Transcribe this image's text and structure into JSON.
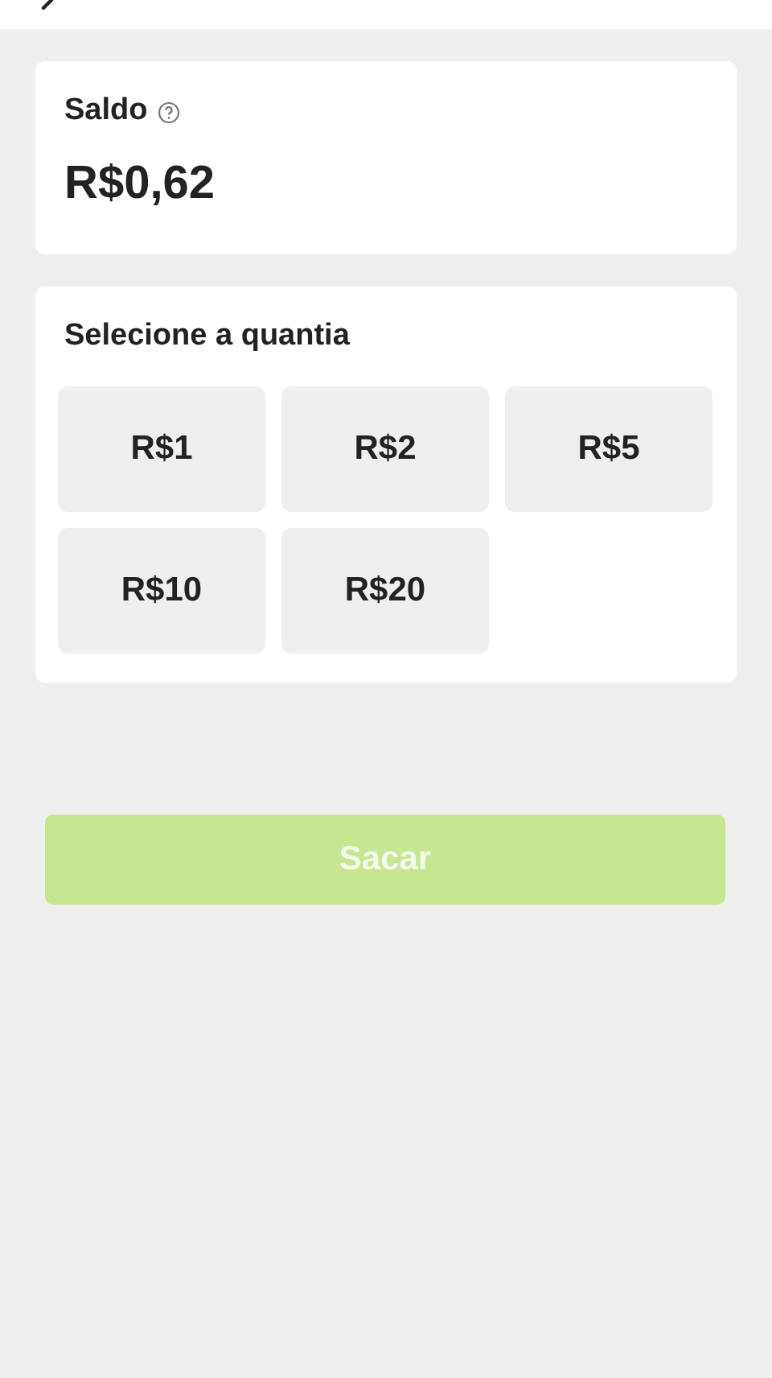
{
  "header": {
    "back": true
  },
  "balance": {
    "label": "Saldo",
    "amount": "R$0,62"
  },
  "amount_picker": {
    "title": "Selecione a quantia",
    "options": [
      {
        "label": "R$1",
        "selected": false
      },
      {
        "label": "R$2",
        "selected": false
      },
      {
        "label": "R$5",
        "selected": false
      },
      {
        "label": "R$10",
        "selected": false
      },
      {
        "label": "R$20",
        "selected": false
      }
    ]
  },
  "withdraw_button": {
    "label": "Sacar",
    "disabled": true
  }
}
